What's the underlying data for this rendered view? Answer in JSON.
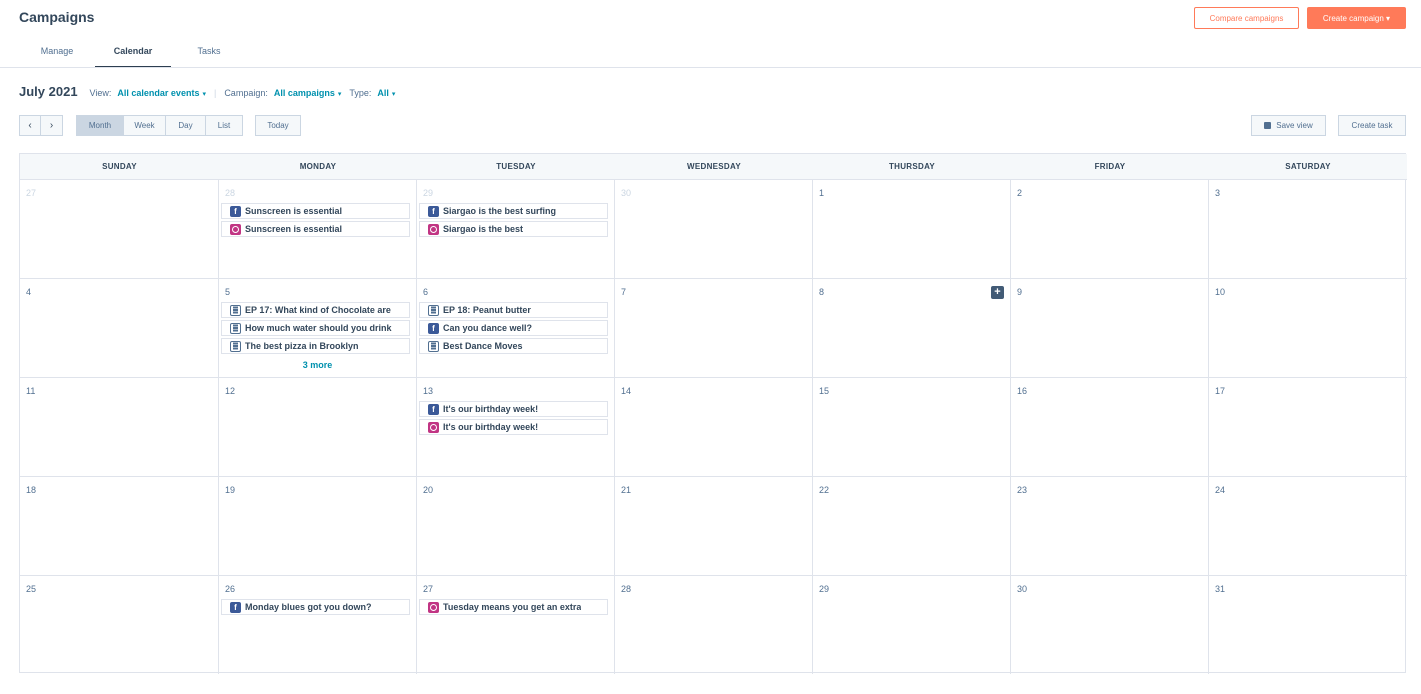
{
  "header": {
    "title": "Campaigns",
    "compare_label": "Compare campaigns",
    "create_label": "Create campaign ▾"
  },
  "tabs": [
    {
      "label": "Manage"
    },
    {
      "label": "Calendar",
      "active": true
    },
    {
      "label": "Tasks"
    }
  ],
  "toolbar": {
    "month": "July 2021",
    "view_label": "View:",
    "view_value": "All calendar events",
    "sep": "|",
    "campaign_label": "Campaign:",
    "campaign_value": "All campaigns",
    "type_label": "Type:",
    "type_value": "All",
    "caret": "▾"
  },
  "controls": {
    "prev": "‹",
    "next": "›",
    "views": [
      {
        "label": "Month",
        "active": true
      },
      {
        "label": "Week"
      },
      {
        "label": "Day"
      },
      {
        "label": "List"
      }
    ],
    "today": "Today",
    "save_view": "Save view",
    "create_task": "Create task"
  },
  "weekdays": [
    "SUNDAY",
    "MONDAY",
    "TUESDAY",
    "WEDNESDAY",
    "THURSDAY",
    "FRIDAY",
    "SATURDAY"
  ],
  "weeks": [
    [
      {
        "day": "27",
        "muted": true,
        "events": []
      },
      {
        "day": "28",
        "muted": true,
        "events": [
          {
            "icon": "facebook-icon",
            "title": "Sunscreen is essential"
          },
          {
            "icon": "instagram-icon",
            "title": "Sunscreen is essential"
          }
        ]
      },
      {
        "day": "29",
        "muted": true,
        "events": [
          {
            "icon": "facebook-icon",
            "title": "Siargao is the best surfing"
          },
          {
            "icon": "instagram-icon",
            "title": "Siargao is the best"
          }
        ]
      },
      {
        "day": "30",
        "muted": true,
        "events": []
      },
      {
        "day": "1",
        "events": []
      },
      {
        "day": "2",
        "events": []
      },
      {
        "day": "3",
        "events": []
      }
    ],
    [
      {
        "day": "4",
        "events": []
      },
      {
        "day": "5",
        "events": [
          {
            "icon": "blog-icon",
            "title": "EP 17: What kind of Chocolate are"
          },
          {
            "icon": "blog-icon",
            "title": "How much water should you drink"
          },
          {
            "icon": "blog-icon",
            "title": "The best pizza in Brooklyn"
          }
        ],
        "more": "3 more"
      },
      {
        "day": "6",
        "events": [
          {
            "icon": "blog-icon",
            "title": "EP 18: Peanut butter"
          },
          {
            "icon": "facebook-icon",
            "title": "Can you dance well?"
          },
          {
            "icon": "blog-icon",
            "title": "Best Dance Moves"
          }
        ]
      },
      {
        "day": "7",
        "events": []
      },
      {
        "day": "8",
        "events": [],
        "add": "+"
      },
      {
        "day": "9",
        "events": []
      },
      {
        "day": "10",
        "events": []
      }
    ],
    [
      {
        "day": "11",
        "events": []
      },
      {
        "day": "12",
        "events": []
      },
      {
        "day": "13",
        "events": [
          {
            "icon": "facebook-icon",
            "title": "It's our birthday week!"
          },
          {
            "icon": "instagram-icon",
            "title": "It's our birthday week!"
          }
        ]
      },
      {
        "day": "14",
        "events": []
      },
      {
        "day": "15",
        "events": []
      },
      {
        "day": "16",
        "events": []
      },
      {
        "day": "17",
        "events": []
      }
    ],
    [
      {
        "day": "18",
        "events": []
      },
      {
        "day": "19",
        "events": []
      },
      {
        "day": "20",
        "events": []
      },
      {
        "day": "21",
        "events": []
      },
      {
        "day": "22",
        "events": []
      },
      {
        "day": "23",
        "events": []
      },
      {
        "day": "24",
        "events": []
      }
    ],
    [
      {
        "day": "25",
        "events": []
      },
      {
        "day": "26",
        "events": [
          {
            "icon": "facebook-icon",
            "title": "Monday blues got you down?"
          }
        ]
      },
      {
        "day": "27",
        "events": [
          {
            "icon": "instagram-icon",
            "title": "Tuesday means you get an extra"
          }
        ]
      },
      {
        "day": "28",
        "events": []
      },
      {
        "day": "29",
        "events": []
      },
      {
        "day": "30",
        "events": []
      },
      {
        "day": "31",
        "events": []
      }
    ]
  ],
  "colors": {
    "accent": "#ff7a59",
    "link": "#0091ae",
    "text": "#33475b",
    "facebook": "#3b5998",
    "instagram": "#c13584"
  }
}
